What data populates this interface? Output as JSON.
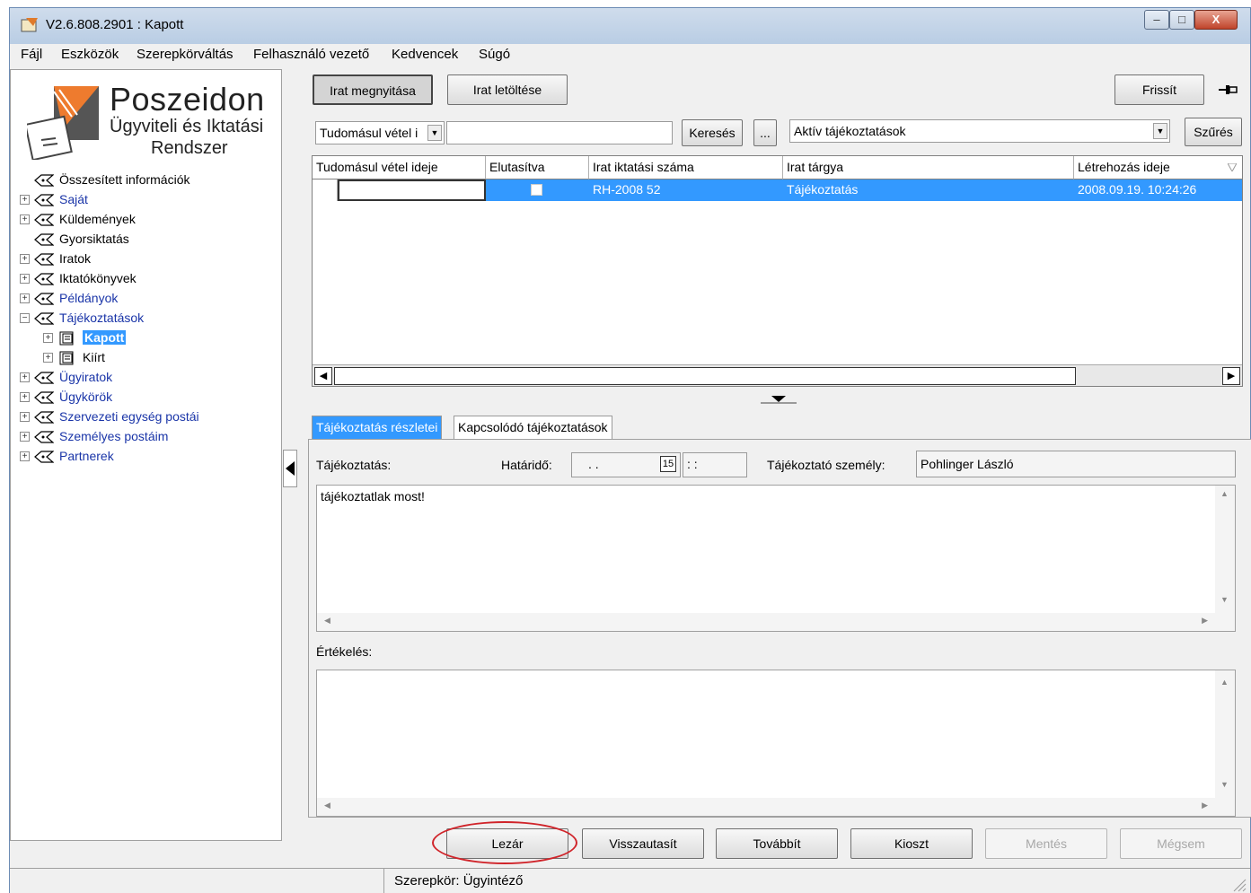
{
  "window": {
    "title": "V2.6.808.2901 : Kapott",
    "minimize_icon": "minimize-icon",
    "maximize_icon": "maximize-icon",
    "close_label": "X"
  },
  "menu": [
    "Fájl",
    "Eszközök",
    "Szerepkörváltás",
    "Felhasználó vezető",
    "Kedvencek",
    "Súgó"
  ],
  "logo": {
    "title": "Poszeidon",
    "subtitle_line1": "Ügyviteli és Iktatási",
    "subtitle_line2": "Rendszer"
  },
  "tree": [
    {
      "label": "Összesített információk",
      "expander": false,
      "blue": false
    },
    {
      "label": "Saját",
      "expander": true,
      "blue": true
    },
    {
      "label": "Küldemények",
      "expander": true,
      "blue": false
    },
    {
      "label": "Gyorsiktatás",
      "expander": false,
      "blue": false
    },
    {
      "label": "Iratok",
      "expander": true,
      "blue": false
    },
    {
      "label": "Iktatókönyvek",
      "expander": true,
      "blue": false
    },
    {
      "label": "Példányok",
      "expander": true,
      "blue": true
    },
    {
      "label": "Tájékoztatások",
      "expander": true,
      "blue": true,
      "expanded": true
    },
    {
      "label": "Kapott",
      "child": true,
      "selected": true
    },
    {
      "label": "Kiírt",
      "child": true
    },
    {
      "label": "Ügyiratok",
      "expander": true,
      "blue": true
    },
    {
      "label": "Ügykörök",
      "expander": true,
      "blue": true
    },
    {
      "label": "Szervezeti egység postái",
      "expander": true,
      "blue": true
    },
    {
      "label": "Személyes postáim",
      "expander": true,
      "blue": true
    },
    {
      "label": "Partnerek",
      "expander": true,
      "blue": true
    }
  ],
  "toolbar": {
    "open_doc": "Irat megnyitása",
    "download_doc": "Irat letöltése",
    "refresh": "Frissít"
  },
  "search": {
    "field_select": "Tudomásul vétel i",
    "query": "",
    "search_btn": "Keresés",
    "more_btn": "...",
    "filter_select": "Aktív tájékoztatások",
    "filter_btn": "Szűrés"
  },
  "grid": {
    "columns": [
      "Tudomásul vétel ideje",
      "Elutasítva",
      "Irat iktatási száma",
      "Irat tárgya",
      "Létrehozás ideje"
    ],
    "rows": [
      {
        "ack_time": "",
        "rejected": false,
        "doc_number": "RH-2008 52",
        "subject": "Tájékoztatás",
        "created": "2008.09.19. 10:24:26"
      }
    ]
  },
  "tabs": [
    "Tájékoztatás részletei",
    "Kapcsolódó tájékoztatások"
  ],
  "details": {
    "info_label": "Tájékoztatás:",
    "deadline_label": "Határidő:",
    "deadline_date": ". .",
    "deadline_time": ": :",
    "calendar_label": "15",
    "person_label": "Tájékoztató személy:",
    "person_value": "Pohlinger László",
    "info_text": "tájékoztatlak most!",
    "evaluation_label": "Értékelés:",
    "evaluation_text": ""
  },
  "actions": {
    "close": "Lezár",
    "reject": "Visszautasít",
    "forward": "Továbbít",
    "distribute": "Kioszt",
    "save": "Mentés",
    "cancel": "Mégsem"
  },
  "status": {
    "role": "Szerepkör: Ügyintéző"
  },
  "colors": {
    "selection": "#3399ff",
    "highlight": "#d0242a",
    "link_blue": "#1a35a8"
  }
}
